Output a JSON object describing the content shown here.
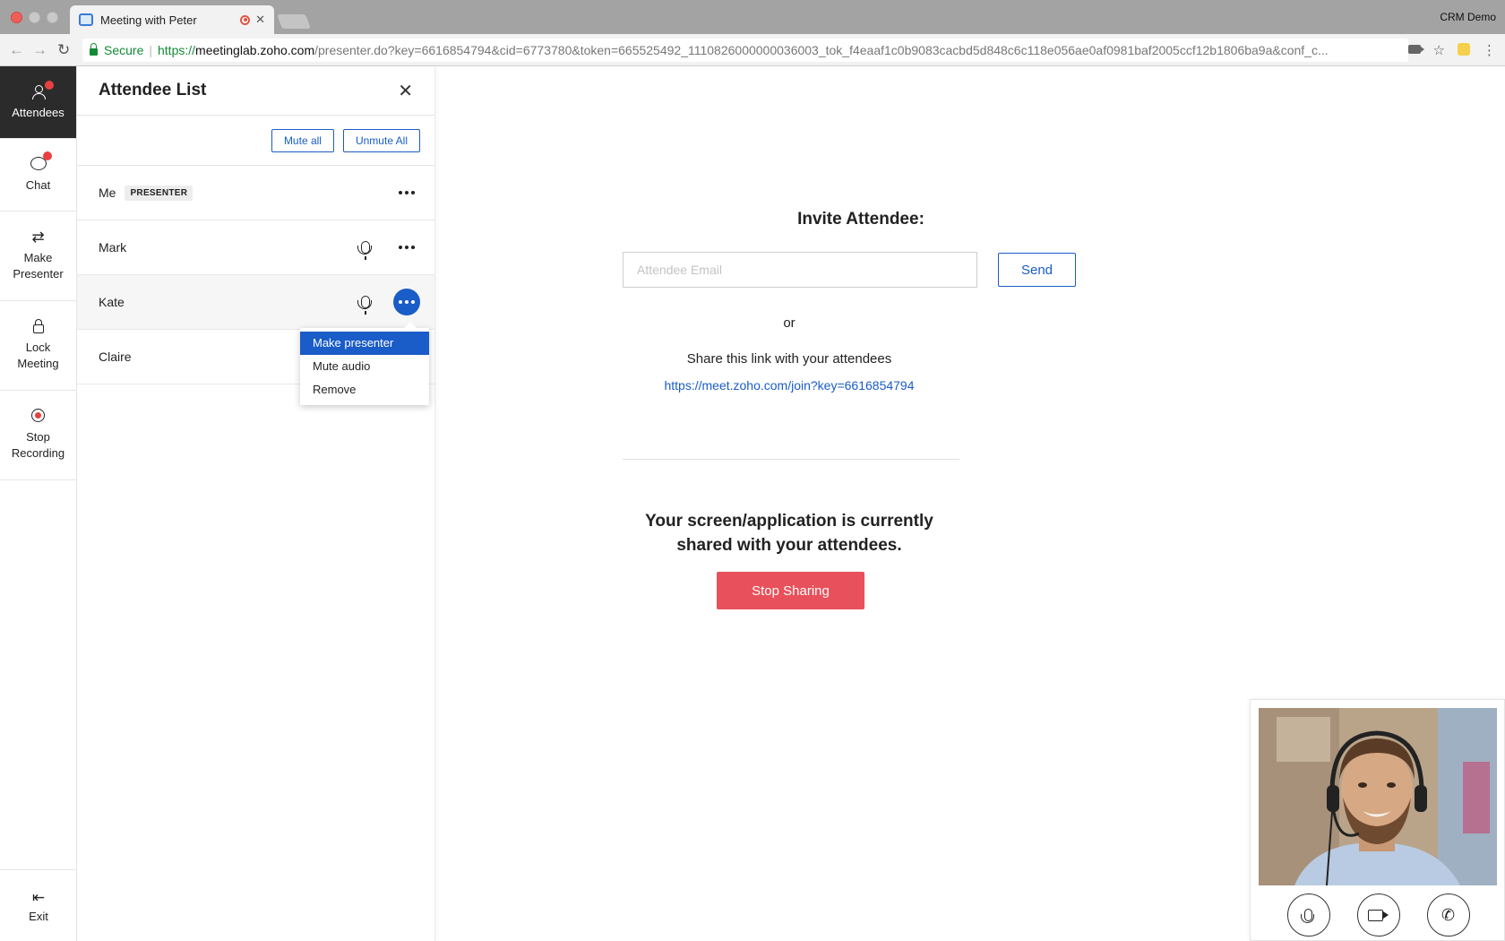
{
  "browser": {
    "tab_title": "Meeting with Peter",
    "tab_close": "✕",
    "profile": "CRM Demo",
    "secure_label": "Secure",
    "separator": "|",
    "url_scheme": "https://",
    "url_host": "meetinglab.zoho.com",
    "url_path": "/presenter.do?key=6616854794&cid=6773780&token=665525492_1110826000000036003_tok_f4eaaf1c0b9083cacbd5d848c6c118e056ae0af0981baf2005ccf12b1806ba9a&conf_c...",
    "back": "←",
    "forward": "→",
    "reload": "↻",
    "star": "☆",
    "menu": "⋮"
  },
  "rail": {
    "attendees": "Attendees",
    "chat": "Chat",
    "make_presenter_1": "Make",
    "make_presenter_2": "Presenter",
    "lock_1": "Lock",
    "lock_2": "Meeting",
    "stop_rec_1": "Stop",
    "stop_rec_2": "Recording",
    "exit": "Exit",
    "swap_glyph": "⇄",
    "exit_glyph": "⇤"
  },
  "panel": {
    "title": "Attendee List",
    "close": "✕",
    "mute_all": "Mute all",
    "unmute_all": "Unmute All",
    "presenter_badge": "PRESENTER",
    "attendees": [
      {
        "name": "Me"
      },
      {
        "name": "Mark"
      },
      {
        "name": "Kate"
      },
      {
        "name": "Claire"
      }
    ],
    "menu": {
      "make_presenter": "Make presenter",
      "mute_audio": "Mute audio",
      "remove": "Remove"
    }
  },
  "main": {
    "invite_title": "Invite Attendee:",
    "email_placeholder": "Attendee Email",
    "send": "Send",
    "or": "or",
    "share_text": "Share this link with your attendees",
    "share_link": "https://meet.zoho.com/join?key=6616854794",
    "screen_msg_1": "Your screen/application is currently",
    "screen_msg_2": "shared with your attendees.",
    "stop_sharing": "Stop Sharing"
  },
  "video": {
    "phone_glyph": "✆"
  },
  "colors": {
    "accent": "#1a5cc8",
    "danger": "#e8505b",
    "rail_active": "#2b2b2b",
    "badge": "#e84040"
  }
}
